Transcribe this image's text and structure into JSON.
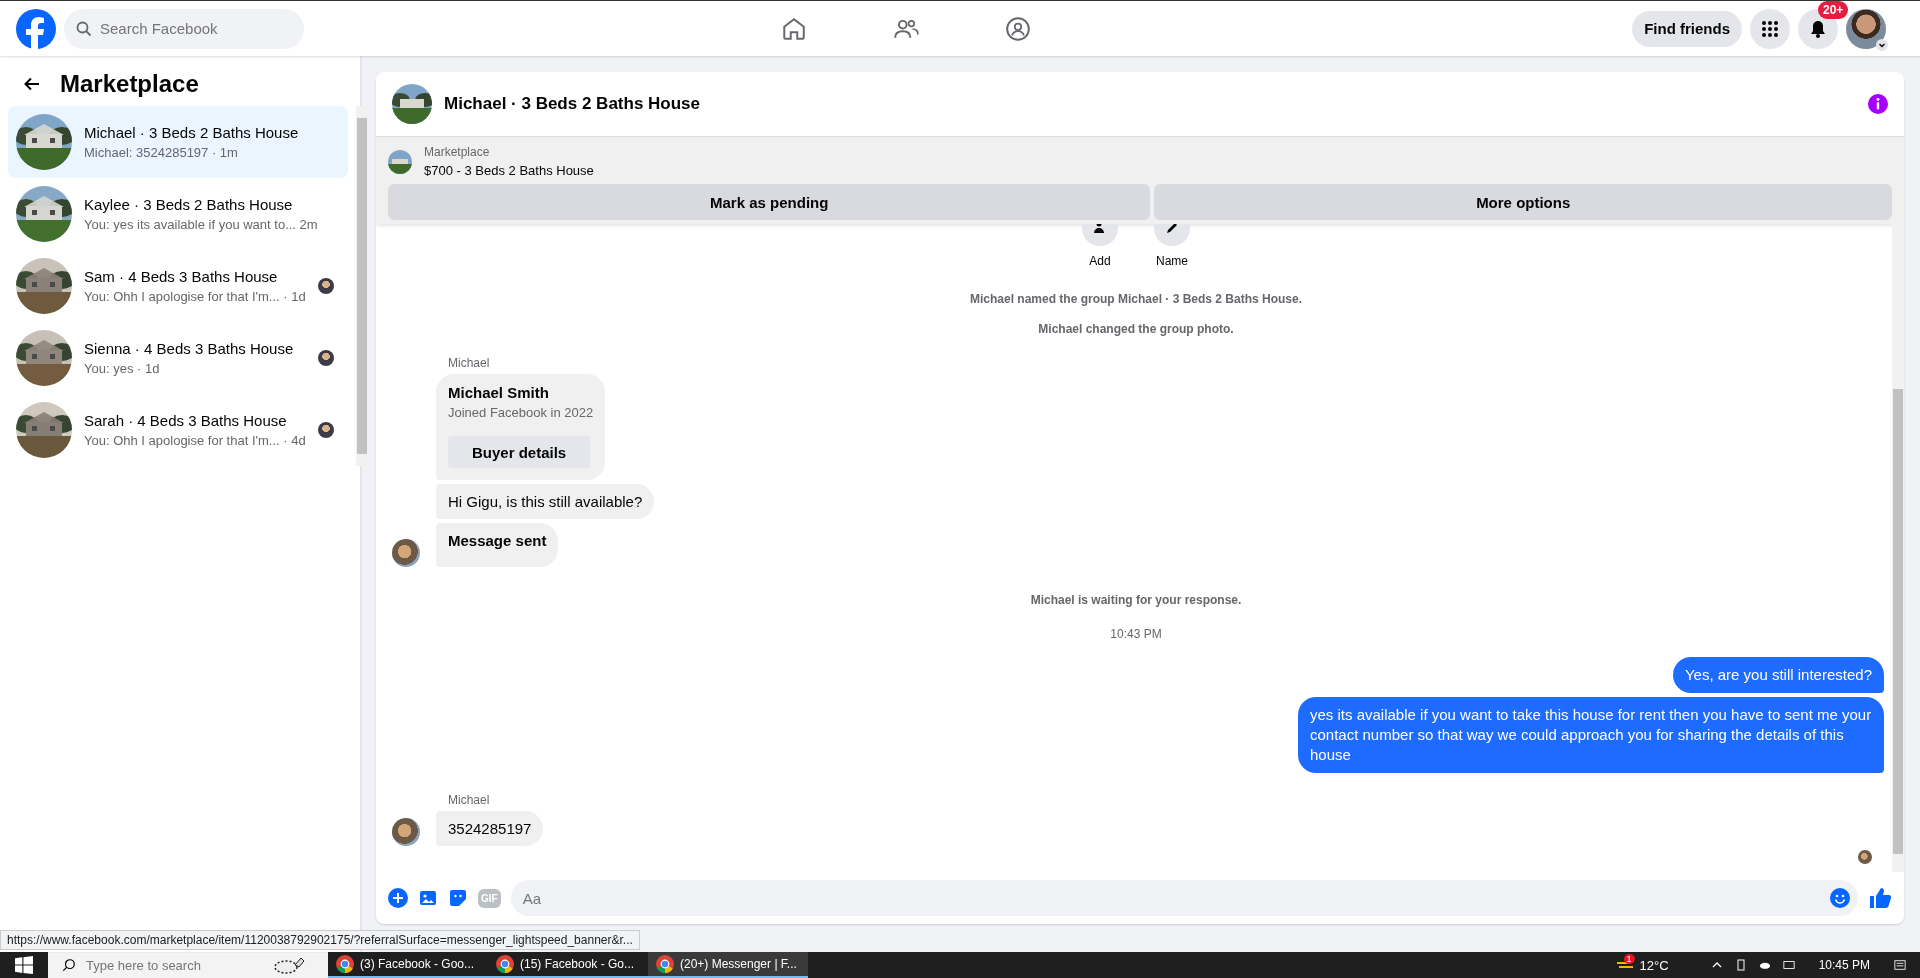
{
  "topbar": {
    "search": {
      "placeholder": "Search Facebook"
    },
    "find_friends": "Find friends",
    "notifications_badge": "20+"
  },
  "sidebar": {
    "title": "Marketplace",
    "conversations": [
      {
        "title": "Michael · 3 Beds 2 Baths House",
        "preview": "Michael: 3524285197 · 1m",
        "selected": true,
        "seen": false
      },
      {
        "title": "Kaylee · 3 Beds 2 Baths House",
        "preview": "You: yes its available if you want to... 2m",
        "selected": false,
        "seen": false
      },
      {
        "title": "Sam · 4 Beds 3 Baths House",
        "preview": "You: Ohh I apologise for that I'm... · 1d",
        "selected": false,
        "seen": true
      },
      {
        "title": "Sienna · 4 Beds 3 Baths House",
        "preview": "You: yes · 1d",
        "selected": false,
        "seen": true
      },
      {
        "title": "Sarah · 4 Beds 3 Baths House",
        "preview": "You: Ohh I apologise for that I'm... · 4d",
        "selected": false,
        "seen": true
      }
    ]
  },
  "chat": {
    "title": "Michael · 3 Beds 2 Baths House",
    "listing": {
      "source": "Marketplace",
      "title": "$700 - 3 Beds 2 Baths House"
    },
    "actions": [
      "Mark as pending",
      "More options"
    ],
    "group_actions": [
      "Add",
      "Name"
    ],
    "messages": [
      {
        "kind": "system",
        "text": "Michael named the group Michael · 3 Beds 2 Baths House."
      },
      {
        "kind": "system",
        "text": "Michael changed the group photo."
      },
      {
        "kind": "sender",
        "text": "Michael"
      },
      {
        "kind": "card",
        "name": "Michael Smith",
        "text": "Joined Facebook in 2022",
        "button": "Buyer details"
      },
      {
        "kind": "incoming",
        "text": "Hi Gigu, is this still available?",
        "bold": false,
        "avatar": false
      },
      {
        "kind": "incoming",
        "text": "Message sent",
        "bold": true,
        "avatar": true
      },
      {
        "kind": "system",
        "text": "Michael is waiting for your response."
      },
      {
        "kind": "time",
        "text": "10:43 PM"
      },
      {
        "kind": "outgoing",
        "text": "Yes, are you still interested?"
      },
      {
        "kind": "outgoing",
        "text": "yes its available if you want to take this house for rent then you have to sent me your contact number so that way we could approach you for sharing the details of this house"
      },
      {
        "kind": "sender",
        "text": "Michael"
      },
      {
        "kind": "incoming",
        "text": "3524285197",
        "bold": false,
        "avatar": true
      }
    ],
    "composer": {
      "placeholder": "Aa",
      "gif": "GIF"
    }
  },
  "status_url": "https://www.facebook.com/marketplace/item/1120038792902175/?referralSurface=messenger_lightspeed_banner&r...",
  "taskbar": {
    "search": {
      "placeholder": "Type here to search"
    },
    "apps": [
      {
        "label": "(3) Facebook - Goo...",
        "selected": false
      },
      {
        "label": "(15) Facebook - Go...",
        "selected": false
      },
      {
        "label": "(20+) Messenger | F...",
        "selected": true
      }
    ],
    "weather_badge": "1",
    "temperature": "12°C",
    "time": "10:45 PM"
  }
}
